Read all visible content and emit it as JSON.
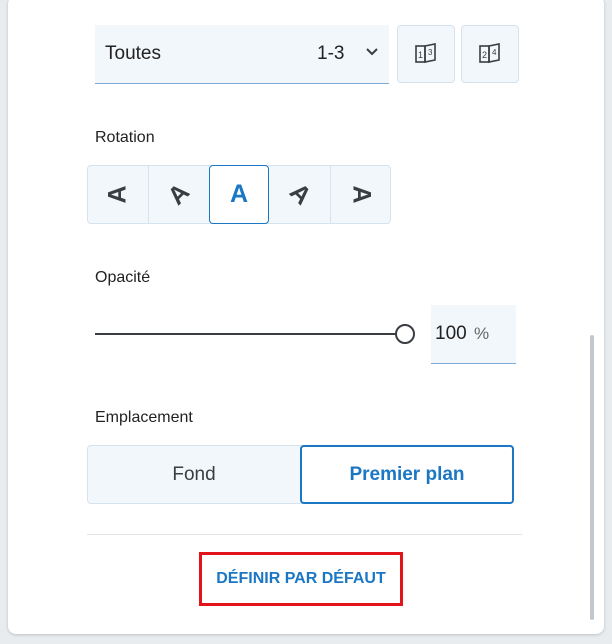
{
  "pages": {
    "selected": "Toutes",
    "range": "1-3",
    "icons": [
      "odd-pages-icon",
      "even-pages-icon"
    ]
  },
  "rotation": {
    "title": "Rotation",
    "glyph": "A",
    "options": [
      "rotate-90-left",
      "rotate-45-left",
      "rotate-0",
      "rotate-45-right",
      "rotate-90-right"
    ],
    "active_index": 2
  },
  "opacity": {
    "title": "Opacité",
    "value": "100",
    "unit": "%",
    "level": 1.0
  },
  "placement": {
    "title": "Emplacement",
    "options": [
      "Fond",
      "Premier plan"
    ],
    "active": "Premier plan"
  },
  "footer": {
    "default_label": "DÉFINIR PAR DÉFAUT"
  },
  "colors": {
    "accent": "#1b77c4",
    "highlight_frame": "#e3131a"
  }
}
